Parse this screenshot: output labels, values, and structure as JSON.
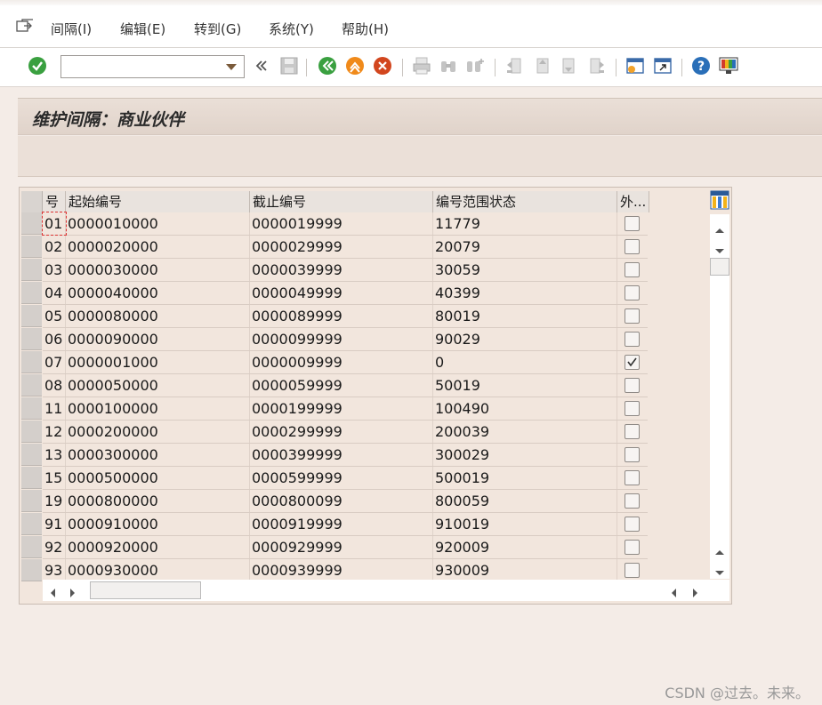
{
  "menu": {
    "items": [
      "间隔(I)",
      "编辑(E)",
      "转到(G)",
      "系统(Y)",
      "帮助(H)"
    ]
  },
  "toolbar": {
    "command_value": "",
    "icons": [
      "enter-icon",
      "back-icon",
      "save-icon",
      "back-green-icon",
      "exit-icon",
      "cancel-icon",
      "print-icon",
      "find-icon",
      "find-next-icon",
      "first-page-icon",
      "prev-page-icon",
      "next-page-icon",
      "last-page-icon",
      "create-session-icon",
      "shortcut-icon",
      "help-icon",
      "layout-icon"
    ],
    "colors": {
      "green": "#3aa040",
      "orange": "#f08a1a",
      "red": "#d2461e",
      "blue": "#2a6fb8"
    }
  },
  "title": "维护间隔：商业伙伴",
  "table": {
    "columns": [
      "号",
      "起始编号",
      "截止编号",
      "编号范围状态",
      "外..."
    ],
    "rows": [
      {
        "no": "01",
        "from": "0000010000",
        "to": "0000019999",
        "status": "11779",
        "ext": false
      },
      {
        "no": "02",
        "from": "0000020000",
        "to": "0000029999",
        "status": "20079",
        "ext": false
      },
      {
        "no": "03",
        "from": "0000030000",
        "to": "0000039999",
        "status": "30059",
        "ext": false
      },
      {
        "no": "04",
        "from": "0000040000",
        "to": "0000049999",
        "status": "40399",
        "ext": false
      },
      {
        "no": "05",
        "from": "0000080000",
        "to": "0000089999",
        "status": "80019",
        "ext": false
      },
      {
        "no": "06",
        "from": "0000090000",
        "to": "0000099999",
        "status": "90029",
        "ext": false
      },
      {
        "no": "07",
        "from": "0000001000",
        "to": "0000009999",
        "status": "0",
        "ext": true
      },
      {
        "no": "08",
        "from": "0000050000",
        "to": "0000059999",
        "status": "50019",
        "ext": false
      },
      {
        "no": "11",
        "from": "0000100000",
        "to": "0000199999",
        "status": "100490",
        "ext": false
      },
      {
        "no": "12",
        "from": "0000200000",
        "to": "0000299999",
        "status": "200039",
        "ext": false
      },
      {
        "no": "13",
        "from": "0000300000",
        "to": "0000399999",
        "status": "300029",
        "ext": false
      },
      {
        "no": "15",
        "from": "0000500000",
        "to": "0000599999",
        "status": "500019",
        "ext": false
      },
      {
        "no": "19",
        "from": "0000800000",
        "to": "0000800099",
        "status": "800059",
        "ext": false
      },
      {
        "no": "91",
        "from": "0000910000",
        "to": "0000919999",
        "status": "910019",
        "ext": false
      },
      {
        "no": "92",
        "from": "0000920000",
        "to": "0000929999",
        "status": "920009",
        "ext": false
      },
      {
        "no": "93",
        "from": "0000930000",
        "to": "0000939999",
        "status": "930009",
        "ext": false
      }
    ]
  },
  "watermark": "CSDN @过去。未来。"
}
